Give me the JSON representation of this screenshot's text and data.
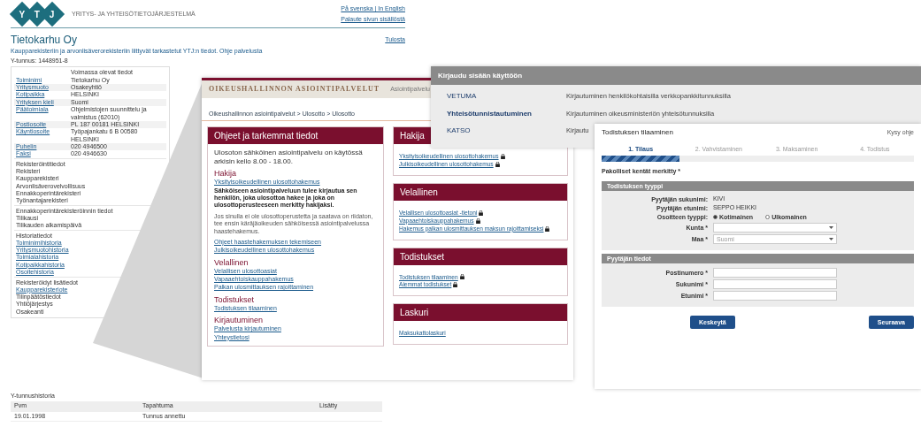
{
  "registry_page": {
    "logo_letters": [
      "Y",
      "T",
      "J"
    ],
    "logo_title": "YRITYS- JA YHTEISÖTIETOJÄRJESTELMÄ",
    "language_links": "På svenska | In English",
    "feedback_link": "Palaute sivun sisällöstä",
    "title": "Tietokarhu Oy",
    "print_link": "Tulosta",
    "intro": "Kaupparekisteriin ja arvonlisäverorekisteriin liittyvät tarkastetut YTJ:n tiedot. Ohje palvelusta",
    "business_id": "Y-tunnus: 1448951-8",
    "details_header": "Voimassa olevat tiedot",
    "details": [
      {
        "label": "Toiminimi",
        "value": "Tietokarhu Oy"
      },
      {
        "label": "Yritysmuoto",
        "value": "Osakeyhtiö"
      },
      {
        "label": "Kotipaikka",
        "value": "HELSINKI"
      },
      {
        "label": "Yrityksen kieli",
        "value": "Suomi"
      },
      {
        "label": "Päätoimiala",
        "value": "Ohjelmistojen suunnittelu ja valmistus (62010)"
      },
      {
        "label": "Postiosoite",
        "value": "PL 187 00181 HELSINKI"
      },
      {
        "label": "Käyntiosoite",
        "value": "Työpajankatu 6 B 00580 HELSINKI"
      },
      {
        "label": "Puhelin",
        "value": "020 4946500"
      },
      {
        "label": "Faksi",
        "value": "020 4946630"
      }
    ],
    "sections": [
      {
        "title": "Rekisteröintitiedot",
        "items": [
          {
            "text": "Rekisteri",
            "link": false
          },
          {
            "text": "Kaupparekisteri",
            "link": false
          },
          {
            "text": "Arvonlisäverovelvollisuus",
            "link": false
          },
          {
            "text": "Ennakkoperintärekisteri",
            "link": false
          },
          {
            "text": "Työnantajarekisteri",
            "link": false
          }
        ]
      },
      {
        "title": "Ennakkoperintärekisteröinnin tiedot",
        "items": [
          {
            "text": "Tilikausi",
            "link": false
          },
          {
            "text": "Tilikauden alkamispäivä",
            "link": false
          }
        ]
      },
      {
        "title": "Historiatiedot",
        "items": [
          {
            "text": "Toiminimihistoria",
            "link": true
          },
          {
            "text": "Yritysmuotohistoria",
            "link": true
          },
          {
            "text": "Toimialahistoria",
            "link": true
          },
          {
            "text": "Kotipaikkahistoria",
            "link": true
          },
          {
            "text": "Osoitehistoria",
            "link": true
          }
        ]
      },
      {
        "title": "Rekisteröidyt lisätiedot",
        "items": [
          {
            "text": "Kaupparekisteriote",
            "link": true
          },
          {
            "text": "Tilinpäätöstiedot",
            "link": false
          },
          {
            "text": "Yhtiöjärjestys",
            "link": false
          },
          {
            "text": "Osakeanti",
            "link": false
          }
        ]
      }
    ],
    "history_title": "Y-tunnushistoria",
    "history_columns": [
      "Pvm",
      "Tapahtuma",
      "Lisätty"
    ],
    "history_rows": [
      [
        "19.01.1998",
        "Tunnus annettu"
      ]
    ]
  },
  "services_page": {
    "brand": "OIKEUSHALLINNON ASIOINTIPALVELUT",
    "top_link": "Asiointipalvelu",
    "breadcrumb": "Oikeushallinnon asiointipalvelut > Ulosotto > Ulosotto",
    "info_card": {
      "title": "Ohjeet ja tarkemmat tiedot",
      "lead": "Ulosoton sähköinen asiointipalvelu on käytössä arkisin kello 8.00 - 18.00.",
      "blocks": [
        {
          "kind": "heading",
          "text": "Hakija"
        },
        {
          "kind": "link",
          "text": "Yksityisoikeudellinen ulosottohakemus"
        },
        {
          "kind": "strong",
          "text": "Sähköiseen asiointipalveluun tulee kirjautua sen henkilön, joka ulosottoa hakee ja joka on ulosottoperusteeseen merkitty hakijaksi."
        },
        {
          "kind": "note",
          "text": "Jos sinulla ei ole ulosottoperustetta ja saatava on riidaton, tee ensin käräjäoikeuden sähköisessä asiointipalvelussa haastehakemus."
        },
        {
          "kind": "link",
          "text": "Ohjeet haastehakemuksen tekemiseen"
        },
        {
          "kind": "link",
          "text": "Julkisoikeudellinen ulosottohakemus"
        },
        {
          "kind": "heading",
          "text": "Velallinen"
        },
        {
          "kind": "link",
          "text": "Velallisen ulosottoasiat"
        },
        {
          "kind": "link",
          "text": "Vapaaehtoiskauppahakemus"
        },
        {
          "kind": "link",
          "text": "Palkan ulosmittauksen rajoittaminen"
        },
        {
          "kind": "heading",
          "text": "Todistukset"
        },
        {
          "kind": "link",
          "text": "Todistuksen tilaaminen"
        },
        {
          "kind": "heading",
          "text": "Kirjautuminen"
        },
        {
          "kind": "link",
          "text": "Palvelusta kirjautuminen"
        },
        {
          "kind": "link",
          "text": "Yhteystietosi"
        }
      ]
    },
    "cards": [
      {
        "title": "Hakija",
        "links": [
          {
            "text": "Yksityisoikeudellinen ulosottohakemus",
            "locked": true
          },
          {
            "text": "Julkisoikeudellinen ulosottohakemus",
            "locked": true
          }
        ]
      },
      {
        "title": "Velallinen",
        "links": [
          {
            "text": "Velallisen ulosottoasiat -tietoni",
            "locked": true
          },
          {
            "text": "Vapaaehtoiskauppahakemus",
            "locked": true
          },
          {
            "text": "Hakemus palkan ulosmittauksen maksun rajoittamiseksi",
            "locked": true
          }
        ]
      },
      {
        "title": "Todistukset",
        "links": [
          {
            "text": "Todistuksen tilaaminen",
            "locked": true
          },
          {
            "text": "Aiemmat todistukset",
            "locked": true
          }
        ]
      },
      {
        "title": "Laskuri",
        "links": [
          {
            "text": "Maksukattolaskuri",
            "locked": false
          }
        ]
      }
    ]
  },
  "login_panel": {
    "title": "Kirjaudu sisään käyttöön",
    "methods": [
      {
        "name": "VETUMA",
        "description": "Kirjautuminen henkilökohtaisilla verkkopankkitunnuksilla"
      },
      {
        "name": "Yhteisötunnistautuminen",
        "description": "Kirjautuminen oikeusministeriön yhteisötunnuksilla"
      },
      {
        "name": "KATSO",
        "description": "Kirjautu"
      }
    ]
  },
  "order_form": {
    "title": "Todistuksen tilaaminen",
    "help_link": "Kysy ohje",
    "steps": [
      {
        "label": "1. Tilaus",
        "selected": true
      },
      {
        "label": "2. Vahvistaminen",
        "selected": false
      },
      {
        "label": "3. Maksaminen",
        "selected": false
      },
      {
        "label": "4. Todistus",
        "selected": false
      }
    ],
    "progress": {
      "level": 0.25
    },
    "required_note": "Pakolliset kentät merkitty *",
    "sections": [
      {
        "title": "Todistuksen tyyppi",
        "rows": [
          {
            "kind": "text",
            "label": "Pyytäjän sukunimi:",
            "value": "KIVI"
          },
          {
            "kind": "text",
            "label": "Pyytäjän etunimi:",
            "value": "SEPPO HEIKKI"
          },
          {
            "kind": "radio",
            "label": "Osoitteen tyyppi:",
            "options": [
              {
                "label": "Kotimainen",
                "selected": true
              },
              {
                "label": "Ulkomainen",
                "selected": false
              }
            ]
          },
          {
            "kind": "select",
            "label": "Kunta *"
          },
          {
            "kind": "select",
            "label": "Maa *",
            "placeholder": "Suomi"
          }
        ]
      },
      {
        "title": "Pyytäjän tiedot",
        "rows": [
          {
            "kind": "input",
            "label": "Postinumero *"
          },
          {
            "kind": "input",
            "label": "Sukunimi *"
          },
          {
            "kind": "input",
            "label": "Etunimi *"
          }
        ]
      }
    ],
    "buttons": [
      "Keskeytä",
      "Seuraava"
    ]
  }
}
